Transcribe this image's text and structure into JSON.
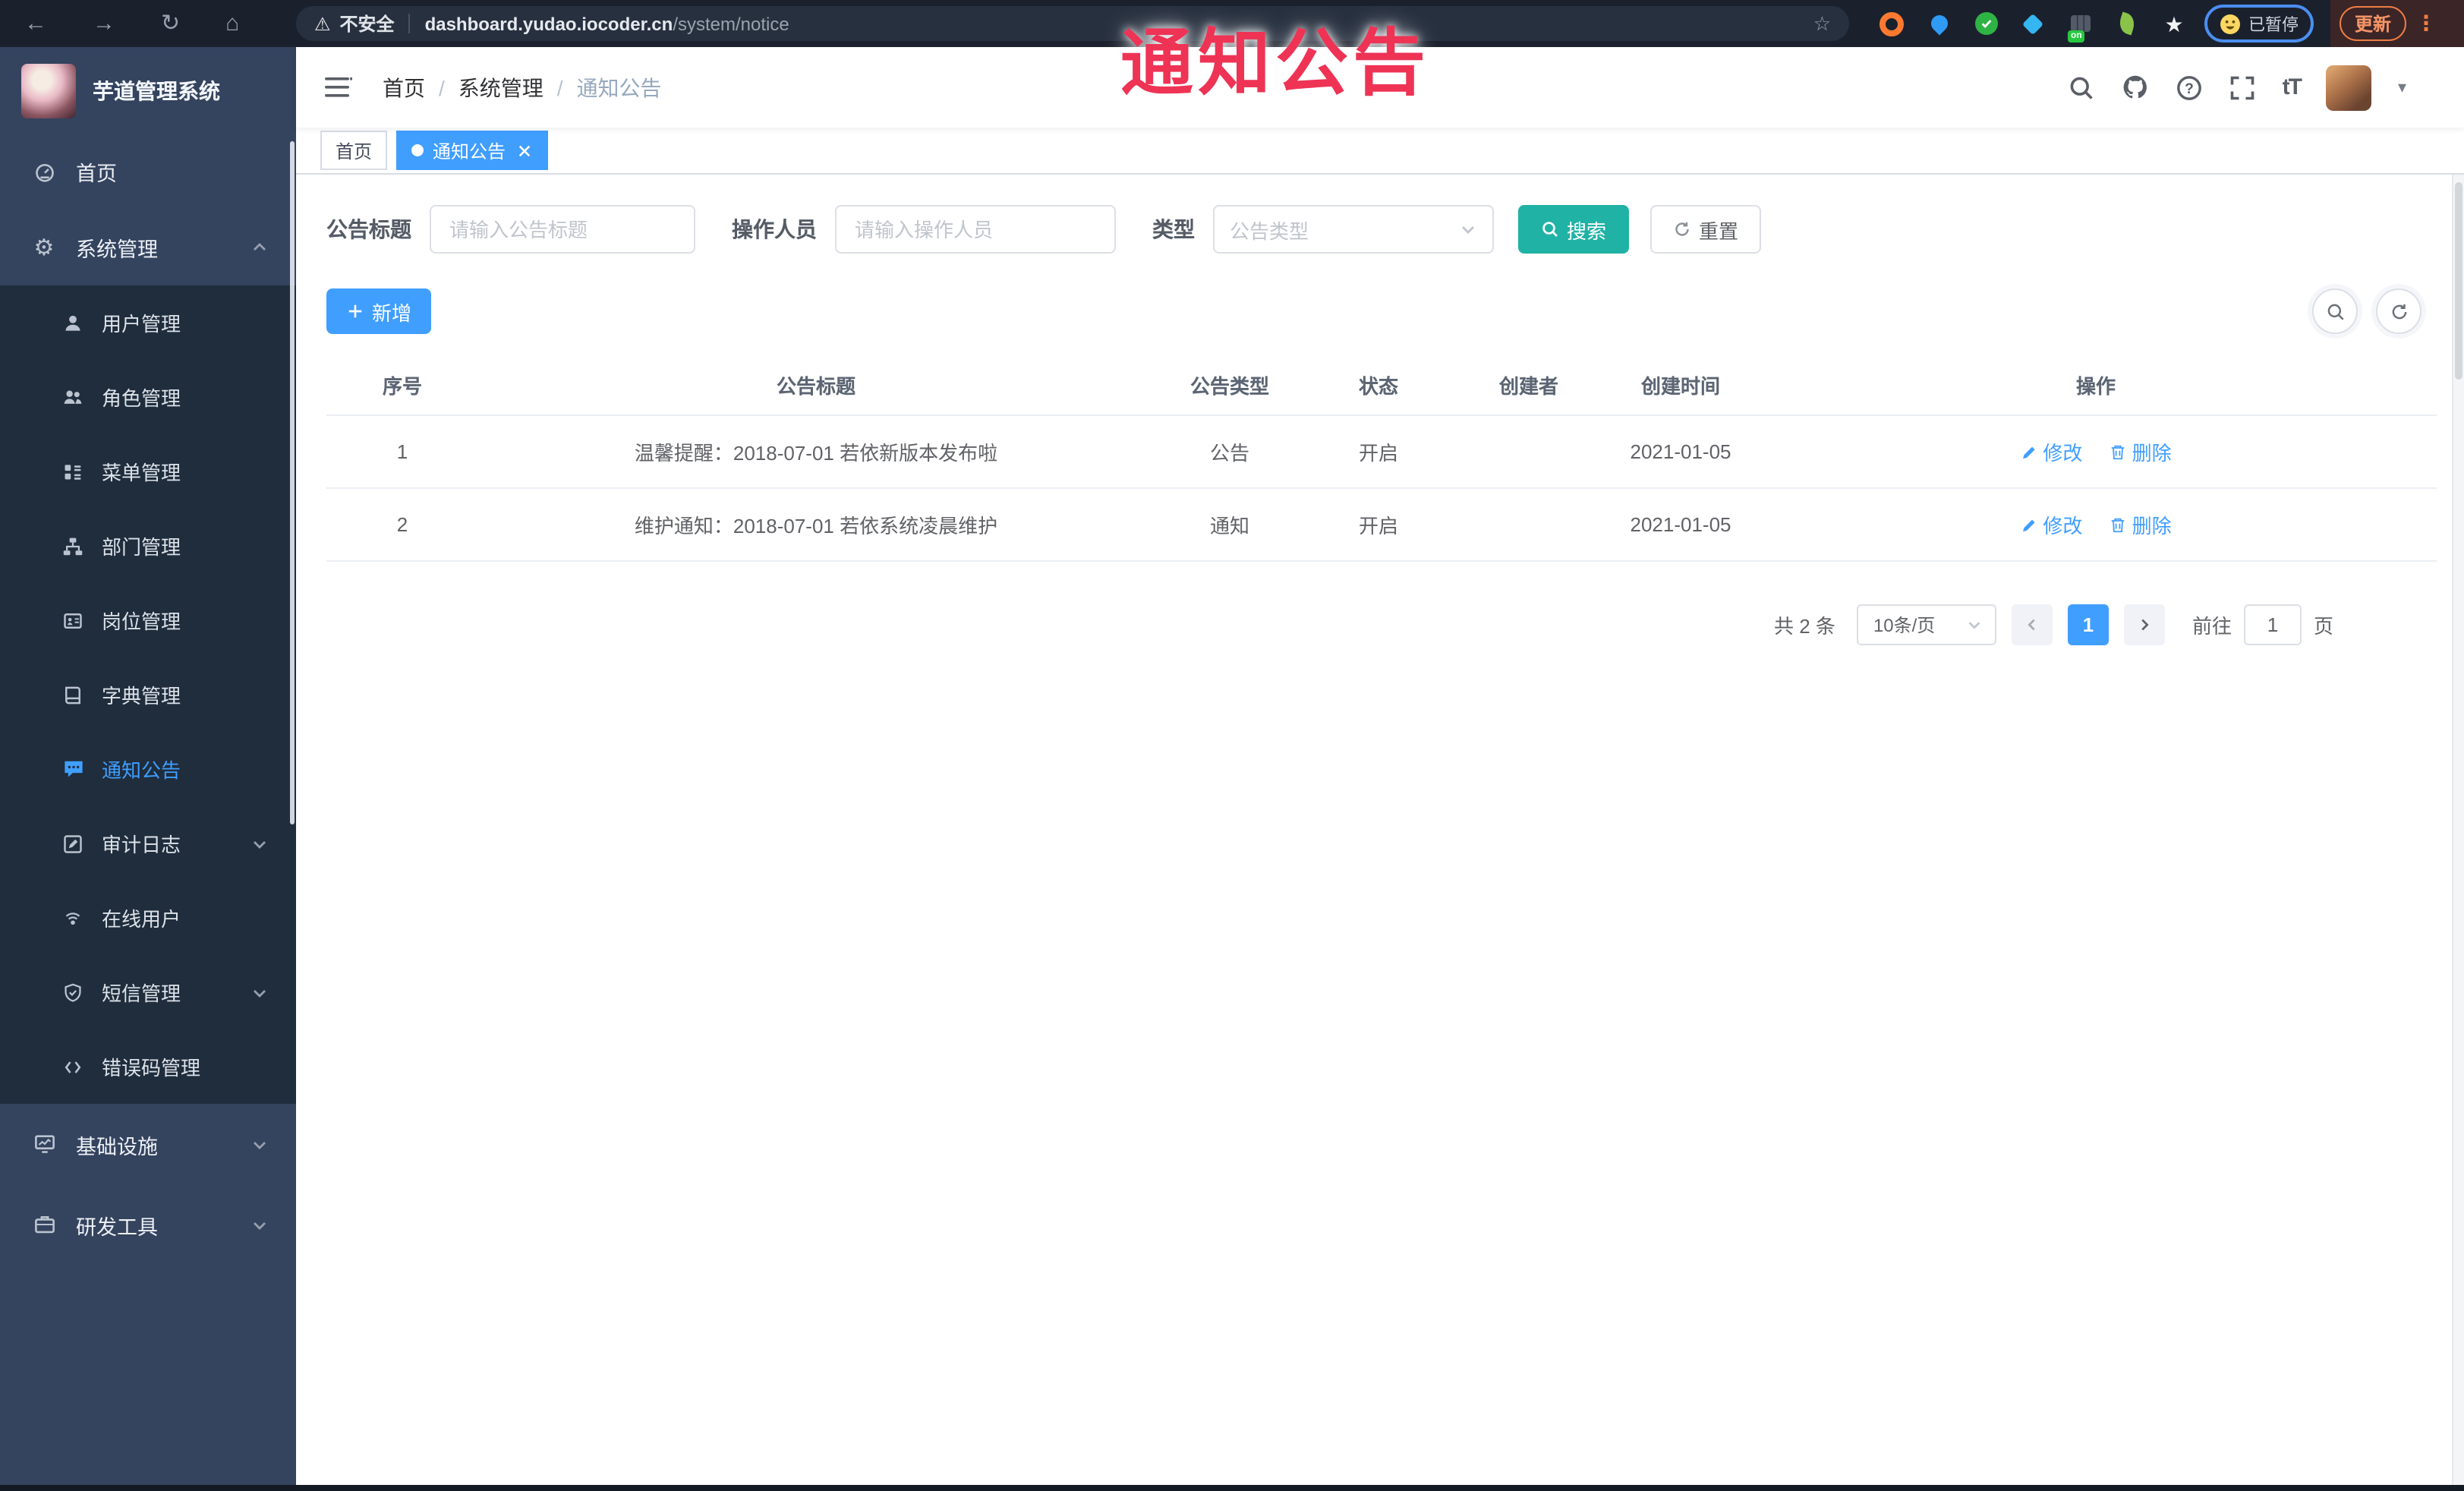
{
  "overlay": {
    "annotation": "通知公告"
  },
  "icons": {
    "back": "←",
    "forward": "→",
    "reload": "↻",
    "home": "⌂",
    "warning": "⚠",
    "bookmark": "☆",
    "star": "★",
    "overflow": "⋮",
    "gear": "⚙",
    "caret_down": "▾"
  },
  "browser": {
    "security_label": "不安全",
    "url_host": "dashboard.yudao.iocoder.cn",
    "url_path": "/system/notice",
    "extension_on_badge": "on",
    "paused_badge": "已暂停",
    "update_button": "更新"
  },
  "sidebar": {
    "logo_title": "芋道管理系统",
    "home": "首页",
    "system": "系统管理",
    "system_children": [
      "用户管理",
      "角色管理",
      "菜单管理",
      "部门管理",
      "岗位管理",
      "字典管理",
      "通知公告",
      "审计日志",
      "在线用户",
      "短信管理",
      "错误码管理"
    ],
    "infrastructure": "基础设施",
    "dev_tools": "研发工具"
  },
  "breadcrumb": {
    "items": [
      "首页",
      "系统管理",
      "通知公告"
    ],
    "separator": "/"
  },
  "header": {
    "font_size_icon_text": "tT"
  },
  "tabs": {
    "home": "首页",
    "active": "通知公告"
  },
  "filters": {
    "title_label": "公告标题",
    "title_placeholder": "请输入公告标题",
    "operator_label": "操作人员",
    "operator_placeholder": "请输入操作人员",
    "type_label": "类型",
    "type_placeholder": "公告类型",
    "search_button": "搜索",
    "reset_button": "重置"
  },
  "toolbar": {
    "add_button": "新增"
  },
  "table": {
    "columns": [
      "序号",
      "公告标题",
      "公告类型",
      "状态",
      "创建者",
      "创建时间",
      "操作"
    ],
    "rows": [
      {
        "no": "1",
        "title": "温馨提醒：2018-07-01 若依新版本发布啦",
        "type": "公告",
        "status": "开启",
        "creator": "",
        "created": "2021-01-05"
      },
      {
        "no": "2",
        "title": "维护通知：2018-07-01 若依系统凌晨维护",
        "type": "通知",
        "status": "开启",
        "creator": "",
        "created": "2021-01-05"
      }
    ],
    "edit_action": "修改",
    "delete_action": "删除"
  },
  "pagination": {
    "total": "共 2 条",
    "page_size": "10条/页",
    "page": "1",
    "goto_label": "前往",
    "goto_value": "1",
    "goto_suffix": "页"
  },
  "colors": {
    "accent_blue": "#409EFF",
    "search_teal": "#20B2A5",
    "annotation_red": "#EE3355",
    "sidebar_bg": "#34435E",
    "sidebar_submenu_bg": "#1F2D3D",
    "tab_active_bg": "#409EFF"
  }
}
